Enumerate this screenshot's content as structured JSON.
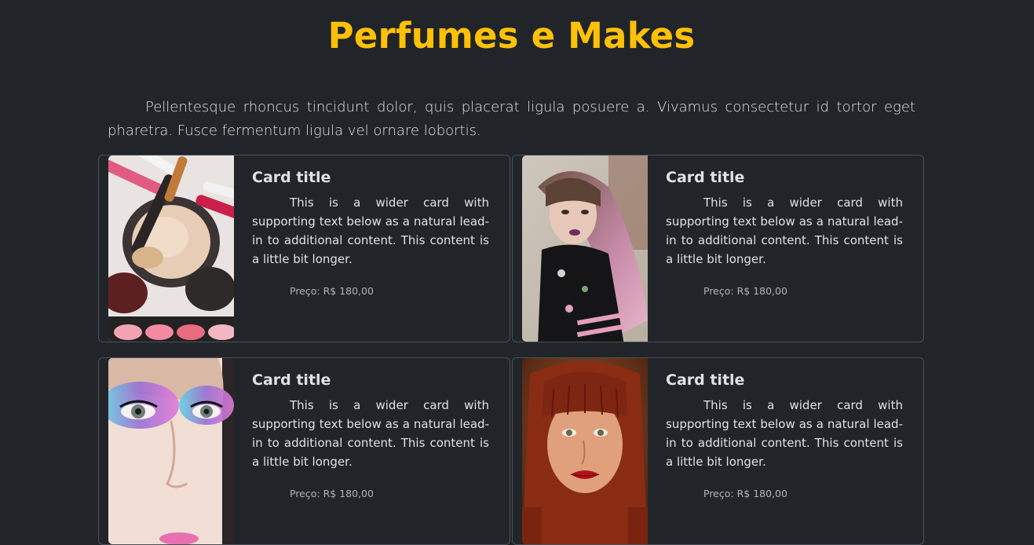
{
  "page": {
    "title": "Perfumes e Makes",
    "intro": "Pellentesque rhoncus tincidunt dolor, quis placerat ligula posuere a. Vivamus consectetur id tortor eget pharetra. Fusce fermentum ligula vel ornare lobortis."
  },
  "colors": {
    "background": "#212529",
    "accent": "#ffc107",
    "text": "#dee2e6",
    "card_border": "#495057"
  },
  "cards": [
    {
      "image": "makeup-products-photo",
      "title": "Card title",
      "text": "This is a wider card with supporting text below as a natural lead-in to additional content. This content is a little bit longer.",
      "price": "Preço: R$ 180,00"
    },
    {
      "image": "woman-pink-hair-photo",
      "title": "Card title",
      "text": "This is a wider card with supporting text below as a natural lead-in to additional content. This content is a little bit longer.",
      "price": "Preço: R$ 180,00"
    },
    {
      "image": "colorful-eye-makeup-photo",
      "title": "Card title",
      "text": "This is a wider card with supporting text below as a natural lead-in to additional content. This content is a little bit longer.",
      "price": "Preço: R$ 180,00"
    },
    {
      "image": "woman-red-hair-photo",
      "title": "Card title",
      "text": "This is a wider card with supporting text below as a natural lead-in to additional content. This content is a little bit longer.",
      "price": "Preço: R$ 180,00"
    }
  ]
}
